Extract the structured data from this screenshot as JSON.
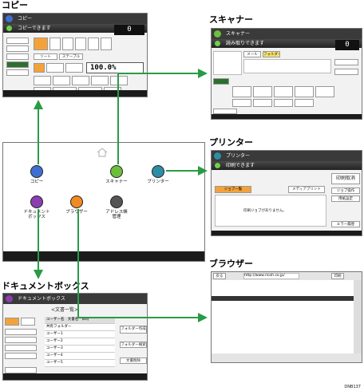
{
  "labels": {
    "copy": "コピー",
    "scanner": "スキャナー",
    "printer": "プリンター",
    "browser": "ブラウザー",
    "docbox": "ドキュメントボックス"
  },
  "home": {
    "apps": [
      {
        "name": "コピー",
        "icon": "copy-icon",
        "color": "#3f6fd0"
      },
      {
        "name": "スキャナー",
        "icon": "scanner-icon",
        "color": "#6bbf3a"
      },
      {
        "name": "プリンター",
        "icon": "printer-icon",
        "color": "#2e8ea6"
      },
      {
        "name": "ドキュメント\nボックス",
        "icon": "document-box-icon",
        "color": "#8a3fb0"
      },
      {
        "name": "ブラウザー",
        "icon": "browser-icon",
        "color": "#f08a24"
      },
      {
        "name": "アドレス帳\n管理",
        "icon": "address-book-icon",
        "color": "#555555"
      }
    ]
  },
  "copy_screen": {
    "title": "コピー",
    "status": "コピーできます",
    "ratio": "100.0%",
    "counter": "0",
    "sort_label": "ソート",
    "staple_label": "ステープル"
  },
  "scanner_screen": {
    "title": "スキャナー",
    "status": "読み取りできます",
    "tabs": [
      "メール",
      "フォルダー"
    ],
    "counter": "0"
  },
  "printer_screen": {
    "title": "プリンター",
    "status": "印刷できます",
    "tabs": [
      "ジョブ一覧",
      "メディアプリント"
    ],
    "message": "印刷ジョブがありません。",
    "reset_button": "印刷取消",
    "side_buttons": [
      "ジョブ操作",
      "用紙設定",
      "エラー履歴"
    ]
  },
  "browser_screen": {
    "title": "ブラウザー",
    "url": "http://www.ricoh.co.jp/",
    "back_label": "戻る",
    "print_label": "印刷"
  },
  "docbox_screen": {
    "title": "ドキュメントボックス",
    "header": "<文書一覧>",
    "columns": [
      "ユーザー名",
      "文書名",
      "日時"
    ],
    "rows": [
      "共有フォルダー",
      "ユーザー1",
      "ユーザー2",
      "ユーザー3",
      "ユーザー4",
      "ユーザー5"
    ],
    "side_buttons": [
      "フォルダー作成",
      "フォルダー検索",
      "文書削除"
    ]
  },
  "figure_id": "DNB137"
}
